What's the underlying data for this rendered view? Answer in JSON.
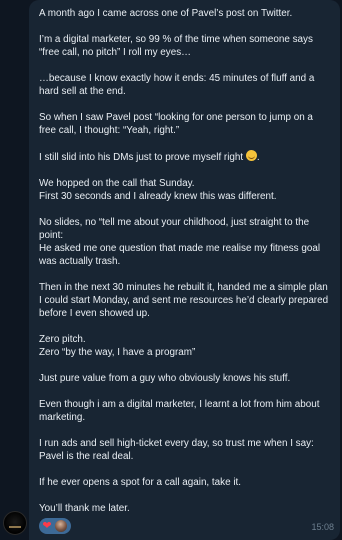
{
  "message": {
    "paragraphs": [
      "A month ago I came across one of Pavel’s post on Twitter.",
      "I’m a digital marketer, so 99 % of the time when someone says “free call, no pitch” I roll my eyes…",
      "…because I know exactly how it ends: 45 minutes of fluff and a hard sell at the end.",
      "So when I saw Pavel post “looking for one person to jump on a free call, I thought: “Yeah, right.”",
      "I still slid into his DMs just to prove myself right",
      "We hopped on the call that Sunday.\nFirst 30 seconds and I already knew this was different.",
      "No slides, no “tell me about your childhood, just straight to the point:\nHe asked me one question that made me realise my fitness goal was actually trash.",
      "Then in the next 30 minutes he rebuilt it, handed me a simple plan I could start Monday, and sent me resources he’d clearly prepared before I even showed up.",
      "Zero pitch.\nZero “by the way, I have a program”",
      "Just pure value from a guy who obviously knows his stuff.",
      "Even though i am a digital marketer, I learnt a lot from him about marketing.",
      "I run ads and sell high-ticket every day, so trust me when I say: Pavel is the real deal.",
      "If he ever opens a spot for a call again, take it.",
      "You’ll thank me later."
    ],
    "time": "15:08",
    "reaction_icons": [
      "heart-icon",
      "reactor-avatar"
    ],
    "emoji_icon": "smirk-emoji-icon"
  },
  "colors": {
    "background": "#0e1621",
    "bubble": "#182533",
    "text": "#e9eef3",
    "time": "#6d7f8f",
    "reaction_pill": "#3d6a97",
    "heart": "#ff3b4a"
  }
}
